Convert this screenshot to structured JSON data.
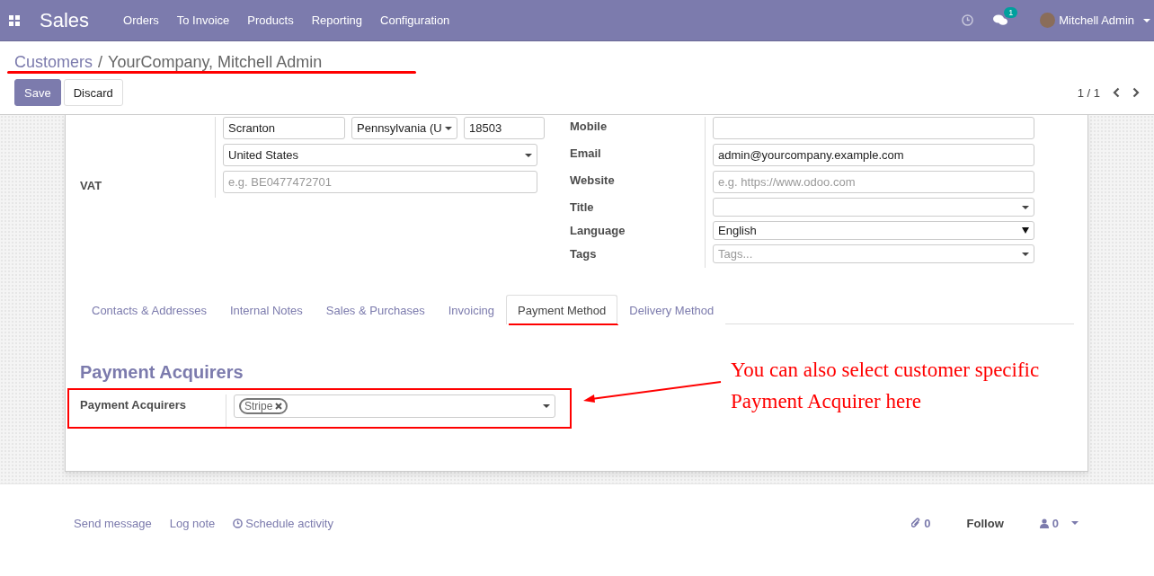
{
  "navbar": {
    "app_name": "Sales",
    "menu": [
      "Orders",
      "To Invoice",
      "Products",
      "Reporting",
      "Configuration"
    ],
    "messages_badge": "1",
    "user": "Mitchell Admin"
  },
  "breadcrumb": {
    "items": [
      "Customers",
      "YourCompany, Mitchell Admin"
    ],
    "separator": "/"
  },
  "buttons": [
    {
      "label": "Save",
      "kind": "primary"
    },
    {
      "label": "Discard",
      "kind": "secondary"
    }
  ],
  "pager": {
    "counter": "1 / 1"
  },
  "address_rows": [
    {
      "fields": [
        {
          "kind": "input",
          "value": "Scranton"
        },
        {
          "kind": "select",
          "value": "Pennsylvania (U"
        },
        {
          "kind": "input",
          "value": "18503"
        }
      ]
    },
    {
      "fields": [
        {
          "kind": "select",
          "value": "United States"
        }
      ]
    },
    {
      "label": "VAT",
      "fields": [
        {
          "kind": "input",
          "placeholder": "e.g. BE0477472701"
        }
      ]
    }
  ],
  "contact_rows": [
    {
      "label": "Mobile",
      "field": {
        "kind": "input"
      }
    },
    {
      "label": "Email",
      "field": {
        "kind": "input",
        "value": "admin@yourcompany.example.com"
      }
    },
    {
      "label": "Website",
      "field": {
        "kind": "input",
        "placeholder": "e.g. https://www.odoo.com"
      }
    },
    {
      "label": "Title",
      "field": {
        "kind": "select"
      }
    },
    {
      "label": "Language",
      "field": {
        "kind": "native-select",
        "value": "English"
      }
    },
    {
      "label": "Tags",
      "field": {
        "kind": "tags",
        "placeholder": "Tags..."
      }
    }
  ],
  "tabs": [
    {
      "label": "Contacts & Addresses",
      "selected": false
    },
    {
      "label": "Internal Notes",
      "selected": false
    },
    {
      "label": "Sales & Purchases",
      "selected": false
    },
    {
      "label": "Invoicing",
      "selected": false
    },
    {
      "label": "Payment Method",
      "selected": true
    },
    {
      "label": "Delivery Method",
      "selected": false
    }
  ],
  "section": {
    "title": "Payment Acquirers",
    "field_label": "Payment Acquirers",
    "tags": [
      "Stripe"
    ]
  },
  "annotation": {
    "lines": [
      "You can also select customer specific",
      "Payment Acquirer here"
    ]
  },
  "chatter": {
    "actions": [
      {
        "label": "Send message",
        "kind": "plain"
      },
      {
        "label": "Log note",
        "kind": "plain"
      },
      {
        "label": "Schedule activity",
        "kind": "clock"
      }
    ],
    "attachments": "0",
    "follow": "Follow",
    "followers": "0"
  }
}
